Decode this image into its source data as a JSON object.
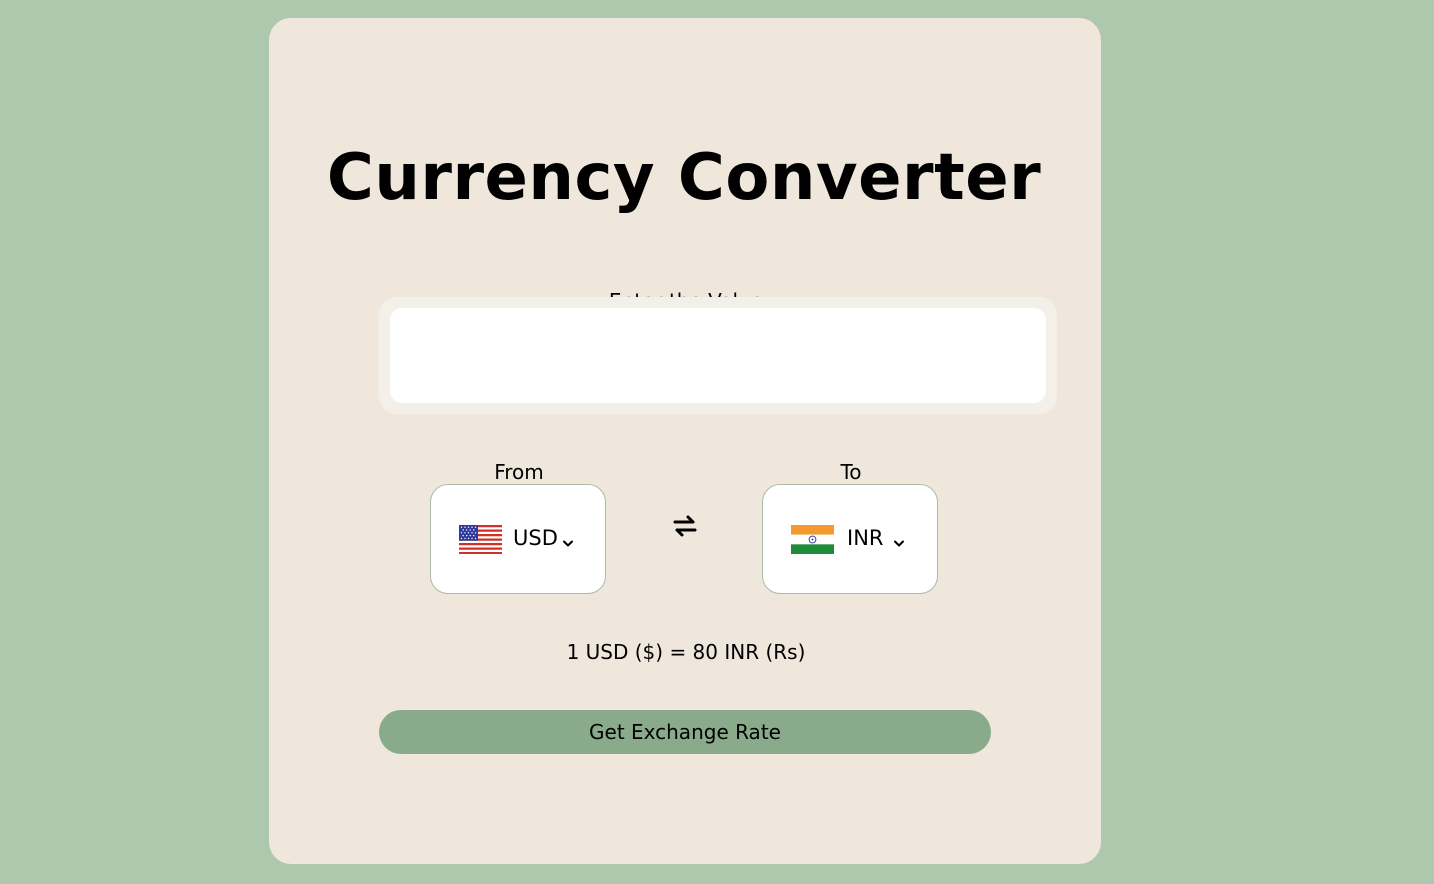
{
  "app": {
    "title": "Currency Converter"
  },
  "amount": {
    "label": "Enter the Value",
    "value": "",
    "placeholder": ""
  },
  "from": {
    "label": "From",
    "currency": "USD",
    "flag_icon": "us-flag-icon"
  },
  "to": {
    "label": "To",
    "currency": "INR",
    "flag_icon": "india-flag-icon"
  },
  "swap": {
    "icon": "swap-arrows-icon"
  },
  "result": {
    "text": "1 USD ($) = 80 INR (Rs)"
  },
  "action": {
    "label": "Get Exchange Rate"
  },
  "colors": {
    "background": "#aec8ad",
    "card": "#efe7dc",
    "button": "#89aa8b",
    "border": "#a9bca8"
  }
}
